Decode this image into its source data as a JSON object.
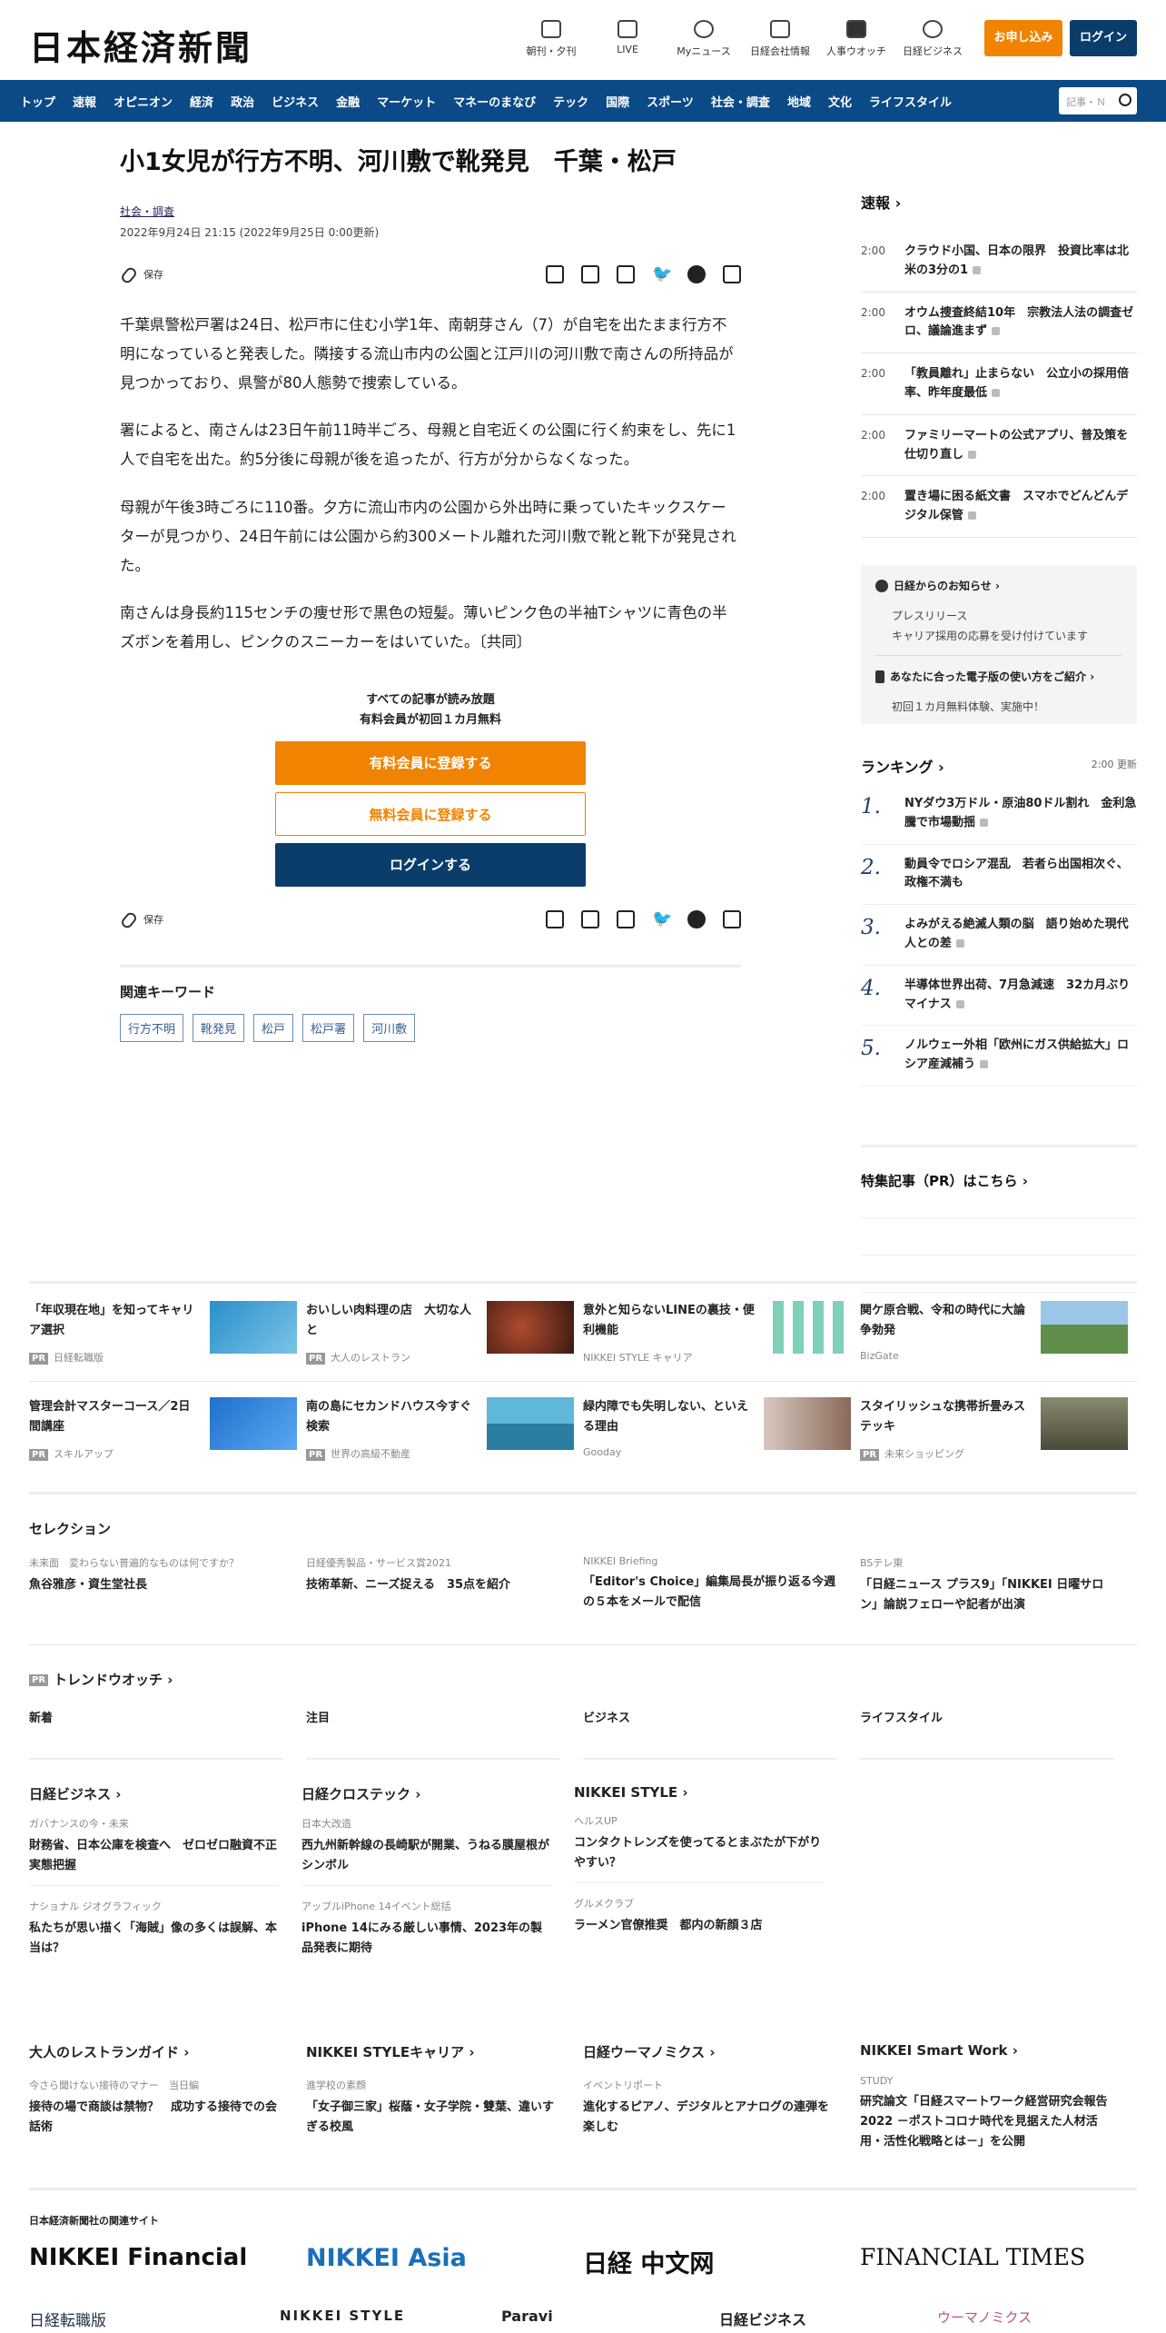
{
  "header": {
    "logo": "日本経済新聞",
    "icons": [
      {
        "label": "朝刊・夕刊",
        "icon": "newspaper-icon"
      },
      {
        "label": "LIVE",
        "icon": "video-icon"
      },
      {
        "label": "Myニュース",
        "icon": "user-icon"
      },
      {
        "label": "日経会社情報",
        "icon": "chart-icon"
      },
      {
        "label": "人事ウオッチ",
        "icon": "search-person-icon"
      },
      {
        "label": "日経ビジネス",
        "icon": "compass-icon"
      }
    ],
    "signup": "お申し込み",
    "login": "ログイン",
    "accent": "#f08300",
    "navy": "#0b3d6b"
  },
  "nav": {
    "items": [
      "トップ",
      "速報",
      "オピニオン",
      "経済",
      "政治",
      "ビジネス",
      "金融",
      "マーケット",
      "マネーのまなび",
      "テック",
      "国際",
      "スポーツ",
      "社会・調査",
      "地域",
      "文化",
      "ライフスタイル"
    ],
    "search_placeholder": "記事・Ｎ"
  },
  "article": {
    "headline": "小1女児が行方不明、河川敷で靴発見　千葉・松戸",
    "category": "社会・調査",
    "date": "2022年9月24日 21:15 (2022年9月25日 0:00更新)",
    "save": "保存",
    "paragraphs": [
      "千葉県警松戸署は24日、松戸市に住む小学1年、南朝芽さん（7）が自宅を出たまま行方不明になっていると発表した。隣接する流山市内の公園と江戸川の河川敷で南さんの所持品が見つかっており、県警が80人態勢で捜索している。",
      "署によると、南さんは23日午前11時半ごろ、母親と自宅近くの公園に行く約束をし、先に1人で自宅を出た。約5分後に母親が後を追ったが、行方が分からなくなった。",
      "母親が午後3時ごろに110番。夕方に流山市内の公園から外出時に乗っていたキックスケーターが見つかり、24日午前には公園から約300メートル離れた河川敷で靴と靴下が発見された。",
      "南さんは身長約115センチの痩せ形で黒色の短髪。薄いピンク色の半袖Tシャツに青色の半ズボンを着用し、ピンクのスニーカーをはいていた。〔共同〕"
    ],
    "paywall": {
      "line1": "すべての記事が読み放題",
      "line2": "有料会員が初回１カ月無料",
      "paid": "有料会員に登録する",
      "free": "無料会員に登録する",
      "login": "ログインする"
    },
    "keywords_title": "関連キーワード",
    "keywords": [
      "行方不明",
      "靴発見",
      "松戸",
      "松戸署",
      "河川敷"
    ]
  },
  "sidebar": {
    "breaking_title": "速報",
    "breaking": [
      {
        "time": "2:00",
        "text": "クラウド小国、日本の限界　投資比率は北米の3分の1"
      },
      {
        "time": "2:00",
        "text": "オウム捜査終結10年　宗教法人法の調査ゼロ、議論進まず"
      },
      {
        "time": "2:00",
        "text": "「教員離れ」止まらない　公立小の採用倍率、昨年度最低"
      },
      {
        "time": "2:00",
        "text": "ファミリーマートの公式アプリ、普及策を仕切り直し"
      },
      {
        "time": "2:00",
        "text": "置き場に困る紙文書　スマホでどんどんデジタル保管"
      }
    ],
    "notice_title": "日経からのお知らせ",
    "notice_items": [
      "プレスリリース",
      "キャリア採用の応募を受け付けています"
    ],
    "ebook_title": "あなたに合った電子版の使い方をご紹介",
    "ebook_items": [
      "初回１カ月無料体験、実施中！"
    ],
    "ranking_title": "ランキング",
    "ranking_time": "2:00 更新",
    "ranking": [
      "NYダウ3万ドル・原油80ドル割れ　金利急騰で市場動揺",
      "動員令でロシア混乱　若者ら出国相次ぐ、政権不満も",
      "よみがえる絶滅人類の脳　語り始めた現代人との差",
      "半導体世界出荷、7月急減速　32カ月ぶりマイナス",
      "ノルウェー外相「欧州にガス供給拡大」ロシア産減補う"
    ],
    "feature_title": "特集記事（PR）はこちら"
  },
  "ads": [
    [
      {
        "text": "「年収現在地」を知ってキャリア選択",
        "src": "日経転職版",
        "pr": true,
        "color": "#3ea6d8"
      },
      {
        "text": "おいしい肉料理の店　大切な人と",
        "src": "大人のレストラン",
        "pr": true,
        "color": "#6a2a1a"
      },
      {
        "text": "意外と知らないLINEの裏技・便利機能",
        "src": "NIKKEI STYLE キャリア",
        "pr": false,
        "color": "#8fd0c0"
      },
      {
        "text": "関ケ原合戦、令和の時代に大論争勃発",
        "src": "BizGate",
        "pr": false,
        "color": "#6fa25a"
      }
    ],
    [
      {
        "text": "管理会計マスターコース／2日間講座",
        "src": "スキルアップ",
        "pr": true,
        "color": "#2c7dd0"
      },
      {
        "text": "南の島にセカンドハウス今すぐ検索",
        "src": "世界の高級不動産",
        "pr": true,
        "color": "#3a9ab8"
      },
      {
        "text": "緑内障でも失明しない、といえる理由",
        "src": "Gooday",
        "pr": false,
        "color": "#b48a7a"
      },
      {
        "text": "スタイリッシュな携帯折畳みステッキ",
        "src": "未来ショッピング",
        "pr": true,
        "color": "#7a7a6a"
      }
    ]
  ],
  "selection": {
    "title": "セレクション",
    "items": [
      {
        "kicker": "未来面　変わらない普遍的なものは何ですか？",
        "text": "魚谷雅彦・資生堂社長"
      },
      {
        "kicker": "日経優秀製品・サービス賞2021",
        "text": "技術革新、ニーズ捉える　35点を紹介"
      },
      {
        "kicker": "NIKKEI Briefing",
        "text": "「Editor's Choice」編集局長が振り返る今週の５本をメールで配信"
      },
      {
        "kicker": "BSテレ東",
        "text": "「日経ニュース プラス9」「NIKKEI 日曜サロン」論説フェローや記者が出演"
      }
    ]
  },
  "trend": {
    "title": "トレンドウオッチ",
    "tabs": [
      "新着",
      "注目",
      "ビジネス",
      "ライフスタイル"
    ]
  },
  "media": [
    {
      "title": "日経ビジネス",
      "items": [
        {
          "kicker": "ガバナンスの今・未来",
          "text": "財務省、日本公庫を検査へ　ゼロゼロ融資不正実態把握"
        },
        {
          "kicker": "ナショナル ジオグラフィック",
          "text": "私たちが思い描く「海賊」像の多くは誤解、本当は？"
        }
      ]
    },
    {
      "title": "日経クロステック",
      "items": [
        {
          "kicker": "日本大改造",
          "text": "西九州新幹線の長崎駅が開業、うねる膜屋根がシンボル"
        },
        {
          "kicker": "アップルiPhone 14イベント総括",
          "text": "iPhone 14にみる厳しい事情、2023年の製品発表に期待"
        }
      ]
    },
    {
      "title": "NIKKEI STYLE",
      "items": [
        {
          "kicker": "ヘルスUP",
          "text": "コンタクトレンズを使ってるとまぶたが下がりやすい？"
        },
        {
          "kicker": "グルメクラブ",
          "text": "ラーメン官僚推奨　都内の新顔３店"
        }
      ]
    }
  ],
  "media2": [
    {
      "title": "大人のレストランガイド",
      "kicker": "今さら聞けない接待のマナー　当日編",
      "text": "接待の場で商談は禁物？　成功する接待での会話術"
    },
    {
      "title": "NIKKEI STYLEキャリア",
      "kicker": "進学校の素顔",
      "text": "「女子御三家」桜蔭・女子学院・雙葉、違いすぎる校風"
    },
    {
      "title": "日経ウーマノミクス",
      "kicker": "イベントリポート",
      "text": "進化するピアノ、デジタルとアナログの連弾を楽しむ"
    },
    {
      "title": "NIKKEI Smart Work",
      "kicker": "STUDY",
      "text": "研究論文「日経スマートワーク経営研究会報告2022 －ポストコロナ時代を見据えた人材活用・活性化戦略とは－」を公開"
    }
  ],
  "related": {
    "title": "日本経済新聞社の関連サイト",
    "logos1": [
      "NIKKEI Financial",
      "NIKKEI Asia",
      "日経 中文网",
      "FINANCIAL TIMES"
    ],
    "logos2": [
      "日経転職版",
      "NIKKEI STYLE",
      "Paravi",
      "日経ビジネス",
      "ウーマノミクス"
    ]
  }
}
